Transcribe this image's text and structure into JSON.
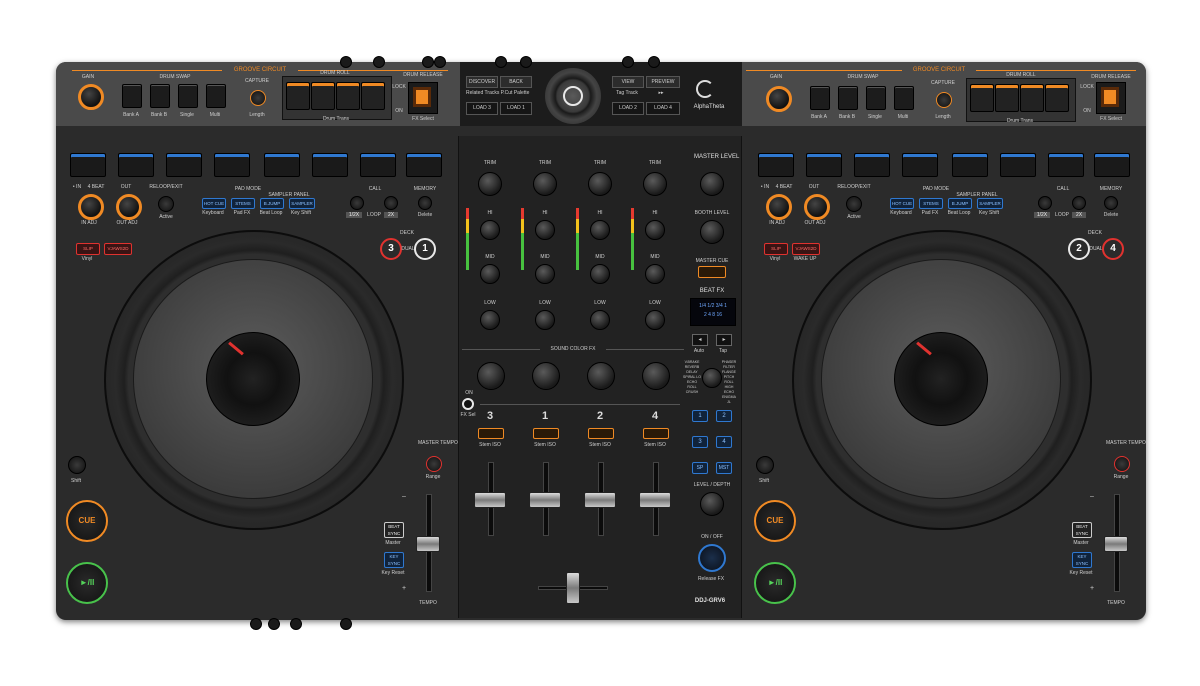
{
  "brand": {
    "name": "AlphaTheta",
    "model": "DDJ-GRV6"
  },
  "top_left": {
    "section": "GROOVE CIRCUIT",
    "gain": "GAIN",
    "drum_swap": "DRUM SWAP",
    "bank_a": "Bank A",
    "bank_b": "Bank B",
    "single": "Single",
    "multi": "Multi",
    "capture": "CAPTURE",
    "length": "Length",
    "drum_roll": "DRUM ROLL",
    "drum_trans": "Drum Trans",
    "drum_release": "DRUM RELEASE",
    "lock": "LOCK",
    "on": "ON",
    "fx_select": "FX Select"
  },
  "top_right": {
    "section": "GROOVE CIRCUIT",
    "gain": "GAIN",
    "drum_swap": "DRUM SWAP",
    "bank_a": "Bank A",
    "bank_b": "Bank B",
    "single": "Single",
    "multi": "Multi",
    "capture": "CAPTURE",
    "length": "Length",
    "drum_roll": "DRUM ROLL",
    "drum_trans": "Drum Trans",
    "drum_release": "DRUM RELEASE",
    "lock": "LOCK",
    "on": "ON",
    "fx_select": "FX Select"
  },
  "browser": {
    "discover": "DISCOVER",
    "back": "BACK",
    "view": "VIEW",
    "preview": "PREVIEW",
    "related": "Related Tracks",
    "fx_palette": "P.Cut Palette",
    "tag_track": "Tag Track",
    "load3": "LOAD 3",
    "load1": "LOAD 1",
    "load2": "LOAD 2",
    "load4": "LOAD 4"
  },
  "left_deck": {
    "in": "• IN",
    "beat4": "4 BEAT",
    "out": "OUT",
    "reloop": "RELOOP/EXIT",
    "in_adj": "IN ADJ",
    "out_adj": "OUT ADJ",
    "active": "Active",
    "pad_mode": "PAD MODE",
    "sampler_panel": "SAMPLER PANEL",
    "hot_cue": "HOT CUE",
    "stems": "STEMS",
    "bjump": "B.JUMP",
    "sampler": "SAMPLER",
    "keyboard": "Keyboard",
    "pad_fx": "Pad FX",
    "beat_loop": "Beat Loop",
    "key_shift": "Key Shift",
    "call": "CALL",
    "loop": "LOOP",
    "x2": "1/2X",
    "x2b": "2X",
    "memory": "MEMORY",
    "delete": "Delete",
    "slip": "SLIP",
    "vj": "VJAWS2D",
    "vinyl": "Vinyl",
    "deck": "DECK",
    "dual": "DUAL",
    "deck_a": "3",
    "deck_b": "1",
    "shift": "Shift",
    "cue": "CUE",
    "play": "►/II",
    "master_tempo": "MASTER TEMPO",
    "range": "Range",
    "beat_sync": "BEAT SYNC",
    "master": "Master",
    "key_sync": "KEY SYNC",
    "key_reset": "Key Reset",
    "tempo": "TEMPO",
    "minus": "–",
    "plus": "+"
  },
  "right_deck": {
    "in": "• IN",
    "beat4": "4 BEAT",
    "out": "OUT",
    "reloop": "RELOOP/EXIT",
    "in_adj": "IN ADJ",
    "out_adj": "OUT ADJ",
    "active": "Active",
    "pad_mode": "PAD MODE",
    "sampler_panel": "SAMPLER PANEL",
    "hot_cue": "HOT CUE",
    "stems": "STEMS",
    "bjump": "B.JUMP",
    "sampler": "SAMPLER",
    "keyboard": "Keyboard",
    "pad_fx": "Pad FX",
    "beat_loop": "Beat Loop",
    "key_shift": "Key Shift",
    "call": "CALL",
    "loop": "LOOP",
    "x2": "1/2X",
    "x2b": "2X",
    "memory": "MEMORY",
    "delete": "Delete",
    "slip": "SLIP",
    "vj": "VJAWS2D",
    "vinyl": "Vinyl",
    "wake_up": "WAKE UP",
    "deck": "DECK",
    "dual": "DUAL",
    "deck_a": "2",
    "deck_b": "4",
    "shift": "Shift",
    "cue": "CUE",
    "play": "►/II",
    "master_tempo": "MASTER TEMPO",
    "range": "Range",
    "beat_sync": "BEAT SYNC",
    "master": "Master",
    "key_sync": "KEY SYNC",
    "key_reset": "Key Reset",
    "tempo": "TEMPO",
    "minus": "–",
    "plus": "+"
  },
  "mixer": {
    "trim": "TRIM",
    "hi": "HI",
    "mid": "MID",
    "low": "LOW",
    "sound_color_fx": "SOUND COLOR FX",
    "on": "ON",
    "fx_sel": "FX Sel",
    "channels": [
      "3",
      "1",
      "2",
      "4"
    ],
    "stem_iso": "Stem ISO",
    "master_level": "MASTER LEVEL",
    "booth_level": "BOOTH LEVEL",
    "master_cue": "MASTER CUE",
    "beat_fx": "BEAT FX",
    "auto": "Auto",
    "tap": "Tap",
    "fx_display_row1": "1/4  1/2  3/4   1",
    "fx_display_row2": "2    4    8   16",
    "fx_names_left": "V.BRAKE REVERB DELAY SPIRAL LO ECHO ROLL CRUSH",
    "fx_names_right": "PHASER FILTER FLANGE PITCH ROLL HIGH ECHO ENIGMA JL",
    "fx_btn1": "1",
    "fx_btn2": "2",
    "fx_btn3": "3",
    "fx_btn4": "4",
    "sp": "SP",
    "mst": "MST",
    "level_depth": "LEVEL / DEPTH",
    "on_off": "ON / OFF",
    "release_fx": "Release FX"
  }
}
